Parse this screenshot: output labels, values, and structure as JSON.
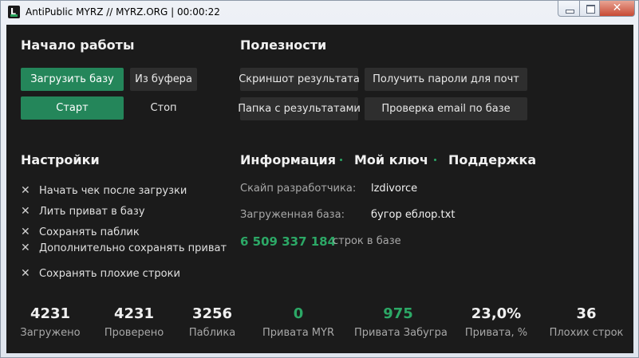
{
  "window": {
    "title": "AntiPublic MYRZ // MYRZ.ORG | 00:00:22",
    "close_glyph": "✕",
    "app_icon_letter": "L"
  },
  "start": {
    "heading": "Начало работы",
    "load_db": "Загрузить базу",
    "from_clipboard": "Из буфера",
    "start": "Старт",
    "stop": "Стоп"
  },
  "useful": {
    "heading": "Полезности",
    "screenshot": "Скриншот результата",
    "get_passwords": "Получить пароли для почт",
    "results_folder": "Папка с результатами",
    "check_email": "Проверка email по базе"
  },
  "settings": {
    "heading": "Настройки",
    "check_glyph": "✕",
    "options": [
      "Начать чек после загрузки",
      "Лить приват в базу",
      "Сохранять паблик",
      "Дополнительно сохранять приват",
      "Сохранять плохие строки"
    ]
  },
  "info": {
    "tab_info": "Информация",
    "tab_key": "Мой ключ",
    "tab_support": "Поддержка",
    "dev_skype_label": "Скайп разработчика:",
    "dev_skype_value": "lzdivorce",
    "loaded_db_label": "Загруженная база:",
    "loaded_db_value": "бугор еблор.txt",
    "rows_count": "6 509 337 184",
    "rows_label": "строк в базе"
  },
  "stats": [
    {
      "value": "4231",
      "label": "Загружено"
    },
    {
      "value": "4231",
      "label": "Проверено"
    },
    {
      "value": "3256",
      "label": "Паблика"
    },
    {
      "value": "0",
      "label": "Привата MYR"
    },
    {
      "value": "975",
      "label": "Привата Забугра"
    },
    {
      "value": "23,0%",
      "label": "Привата, %"
    },
    {
      "value": "36",
      "label": "Плохих строк"
    }
  ],
  "colors": {
    "accent": "#24865a",
    "accent_text": "#2ca866",
    "background": "#1b1b1b",
    "button": "#2e2e2e"
  }
}
